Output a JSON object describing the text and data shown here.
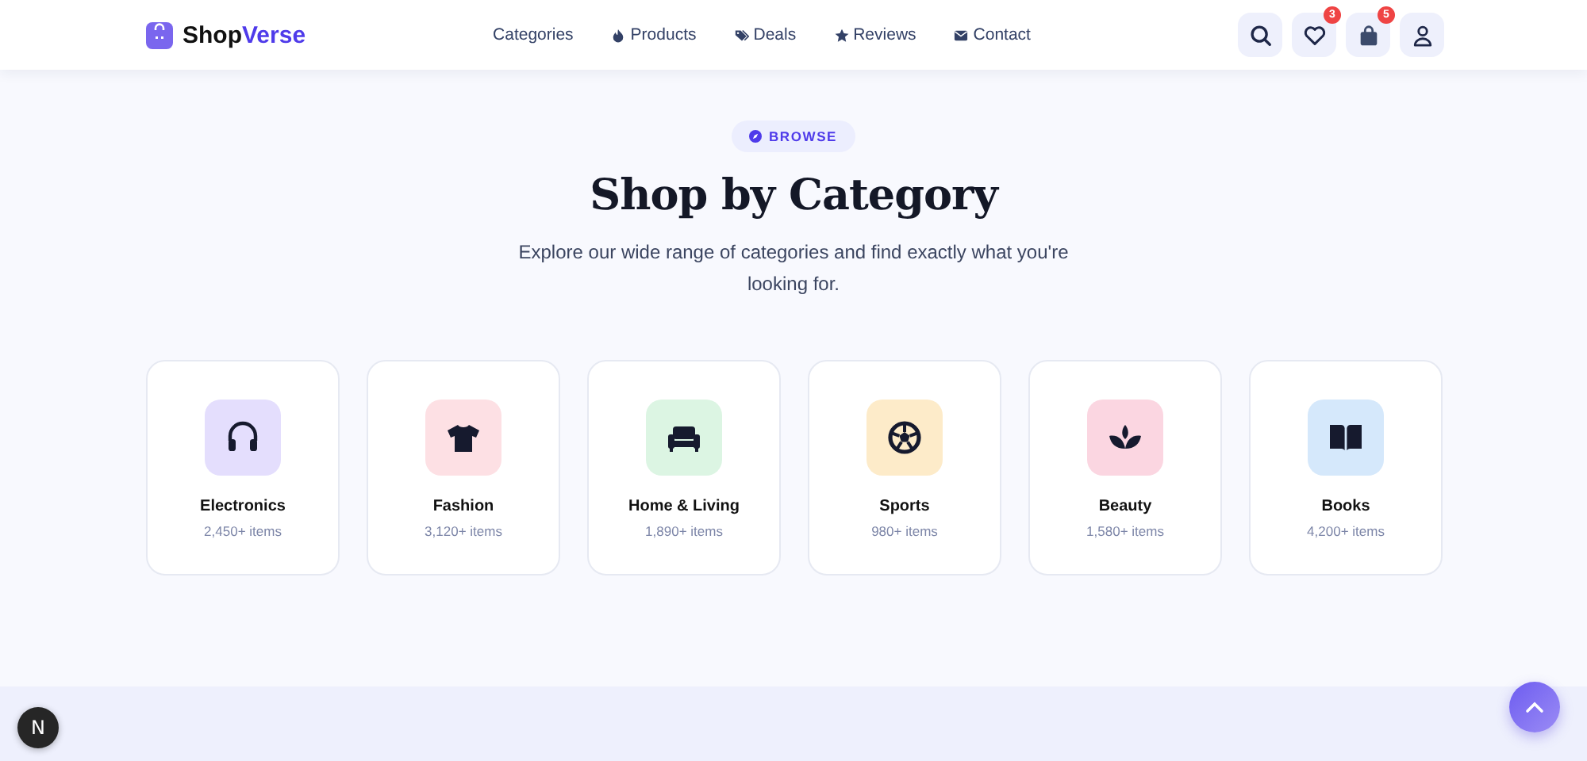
{
  "header": {
    "brand_first": "Shop",
    "brand_second": "Verse",
    "nav": [
      {
        "label": "Categories",
        "kind": "plain"
      },
      {
        "label": "Products",
        "kind": "fire"
      },
      {
        "label": "Deals",
        "kind": "tag"
      },
      {
        "label": "Reviews",
        "kind": "star"
      },
      {
        "label": "Contact",
        "kind": "mail"
      }
    ],
    "actions": [
      {
        "kind": "search"
      },
      {
        "kind": "heart",
        "badge": "3"
      },
      {
        "kind": "bag",
        "badge": "5"
      },
      {
        "kind": "user"
      }
    ]
  },
  "hero": {
    "badge": "BROWSE",
    "title": "Shop by Category",
    "subtitle": "Explore our wide range of categories and find exactly what you're looking for."
  },
  "categories": [
    {
      "name": "Electronics",
      "count": "2,450+ items",
      "kind": "headphones",
      "color": "#e4defd"
    },
    {
      "name": "Fashion",
      "count": "3,120+ items",
      "kind": "shirt",
      "color": "#fde0e4"
    },
    {
      "name": "Home & Living",
      "count": "1,890+ items",
      "kind": "sofa",
      "color": "#dcf5e3"
    },
    {
      "name": "Sports",
      "count": "980+ items",
      "kind": "ball",
      "color": "#fdebc9"
    },
    {
      "name": "Beauty",
      "count": "1,580+ items",
      "kind": "lotus",
      "color": "#fbd6e1"
    },
    {
      "name": "Books",
      "count": "4,200+ items",
      "kind": "book",
      "color": "#d5e8fb"
    }
  ],
  "dev_button": "N"
}
